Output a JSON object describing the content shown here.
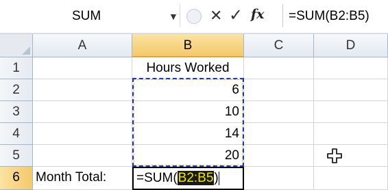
{
  "formula_bar": {
    "name_box": "SUM",
    "formula": "=SUM(B2:B5)",
    "fx_label": "fx"
  },
  "columns": [
    "A",
    "B",
    "C",
    "D"
  ],
  "rows": [
    "1",
    "2",
    "3",
    "4",
    "5",
    "6"
  ],
  "cells": {
    "B1": "Hours Worked",
    "B2": "6",
    "B3": "10",
    "B4": "14",
    "B5": "20",
    "A6": "Month Total:"
  },
  "editing": {
    "cell": "B6",
    "prefix": "=SUM(",
    "reference": "B2:B5",
    "suffix": ")"
  },
  "colors": {
    "selection_header": "#f4c96b",
    "marquee_border": "#1a37c9",
    "reference_highlight_bg": "#1a1a1a",
    "reference_highlight_text": "#f2e600"
  }
}
